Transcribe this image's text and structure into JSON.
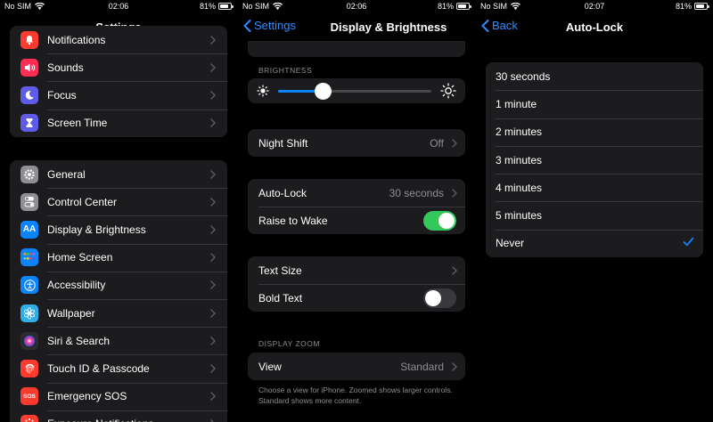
{
  "status_bars": [
    {
      "carrier": "No SIM",
      "time": "02:06",
      "battery": "81%"
    },
    {
      "carrier": "No SIM",
      "time": "02:06",
      "battery": "81%"
    },
    {
      "carrier": "No SIM",
      "time": "02:07",
      "battery": "81%"
    }
  ],
  "battery_level": 0.81,
  "colors": {
    "accent": "#0a84ff",
    "link": "#2f8cff",
    "toggle_on": "#34c759",
    "cell_bg": "#1c1c1e"
  },
  "settings": {
    "title": "Settings",
    "group1": [
      {
        "label": "Notifications",
        "icon": "bell-icon",
        "color": "#ff3b30"
      },
      {
        "label": "Sounds",
        "icon": "speaker-icon",
        "color": "#ff2d55"
      },
      {
        "label": "Focus",
        "icon": "moon-icon",
        "color": "#5e5ce6"
      },
      {
        "label": "Screen Time",
        "icon": "hourglass-icon",
        "color": "#5e5ce6"
      }
    ],
    "group2": [
      {
        "label": "General",
        "icon": "gear-icon",
        "color": "#8e8e93"
      },
      {
        "label": "Control Center",
        "icon": "toggles-icon",
        "color": "#8e8e93"
      },
      {
        "label": "Display & Brightness",
        "icon": "aa-icon",
        "glyph": "AA",
        "color": "#0a84ff"
      },
      {
        "label": "Home Screen",
        "icon": "grid-icon",
        "color": "#0a84ff"
      },
      {
        "label": "Accessibility",
        "icon": "accessibility-icon",
        "color": "#0a84ff"
      },
      {
        "label": "Wallpaper",
        "icon": "flower-icon",
        "color": "#32ade6"
      },
      {
        "label": "Siri & Search",
        "icon": "siri-icon",
        "color": "#2c2c2e"
      },
      {
        "label": "Touch ID & Passcode",
        "icon": "fingerprint-icon",
        "color": "#ff3b30"
      },
      {
        "label": "Emergency SOS",
        "icon": "sos-icon",
        "glyph": "SOS",
        "color": "#ff3b30"
      },
      {
        "label": "Exposure Notifications",
        "icon": "exposure-icon",
        "color": "#ff3b30"
      }
    ]
  },
  "display": {
    "back_label": "Settings",
    "title": "Display & Brightness",
    "brightness_header": "BRIGHTNESS",
    "brightness_level": 0.29,
    "night_shift": {
      "label": "Night Shift",
      "value": "Off"
    },
    "auto_lock": {
      "label": "Auto-Lock",
      "value": "30 seconds"
    },
    "raise_to_wake": {
      "label": "Raise to Wake",
      "on": true
    },
    "text_size": {
      "label": "Text Size"
    },
    "bold_text": {
      "label": "Bold Text",
      "on": false
    },
    "zoom_header": "DISPLAY ZOOM",
    "view": {
      "label": "View",
      "value": "Standard"
    },
    "footnote": "Choose a view for iPhone. Zoomed shows larger controls. Standard shows more content."
  },
  "autolock": {
    "back_label": "Back",
    "title": "Auto-Lock",
    "options": [
      "30 seconds",
      "1 minute",
      "2 minutes",
      "3 minutes",
      "4 minutes",
      "5 minutes",
      "Never"
    ],
    "selected": "Never"
  }
}
